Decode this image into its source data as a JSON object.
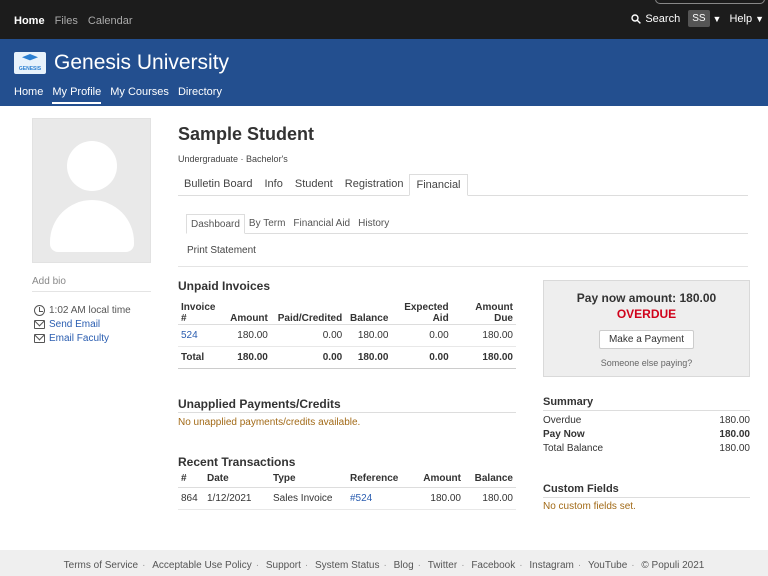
{
  "topnav": {
    "items": [
      "Home",
      "Files",
      "Calendar"
    ],
    "search": "Search",
    "avatar": "SS",
    "help": "Help"
  },
  "brand": {
    "logo_text": "GENESIS",
    "name": "Genesis University"
  },
  "mainnav": [
    "Home",
    "My Profile",
    "My Courses",
    "Directory"
  ],
  "profile": {
    "add_bio": "Add bio",
    "local_time": "1:02 AM local time",
    "send_email": "Send Email",
    "email_faculty": "Email Faculty",
    "name": "Sample Student",
    "subtitle": "Undergraduate · Bachelor's",
    "tabs": [
      "Bulletin Board",
      "Info",
      "Student",
      "Registration",
      "Financial"
    ],
    "subtabs": [
      "Dashboard",
      "By Term",
      "Financial Aid",
      "History"
    ],
    "print": "Print Statement"
  },
  "invoices": {
    "title": "Unpaid Invoices",
    "headers": [
      "Invoice #",
      "Amount",
      "Paid/Credited",
      "Balance",
      "Expected Aid",
      "Amount Due"
    ],
    "rows": [
      [
        "524",
        "180.00",
        "0.00",
        "180.00",
        "0.00",
        "180.00"
      ]
    ],
    "total": [
      "Total",
      "180.00",
      "0.00",
      "180.00",
      "0.00",
      "180.00"
    ]
  },
  "unapplied": {
    "title": "Unapplied Payments/Credits",
    "empty": "No unapplied payments/credits available."
  },
  "transactions": {
    "title": "Recent Transactions",
    "headers": [
      "#",
      "Date",
      "Type",
      "Reference",
      "Amount",
      "Balance"
    ],
    "rows": [
      [
        "864",
        "1/12/2021",
        "Sales Invoice",
        "#524",
        "180.00",
        "180.00"
      ]
    ]
  },
  "paynow": {
    "amount": "Pay now amount: 180.00",
    "status": "OVERDUE",
    "button": "Make a Payment",
    "other": "Someone else paying?"
  },
  "summary": {
    "title": "Summary",
    "rows": [
      [
        "Overdue",
        "180.00"
      ],
      [
        "Pay Now",
        "180.00"
      ],
      [
        "Total Balance",
        "180.00"
      ]
    ]
  },
  "custom_fields": {
    "title": "Custom Fields",
    "empty": "No custom fields set."
  },
  "footer": [
    "Terms of Service",
    "Acceptable Use Policy",
    "Support",
    "System Status",
    "Blog",
    "Twitter",
    "Facebook",
    "Instagram",
    "YouTube",
    "© Populi 2021"
  ],
  "colors": {
    "header": "#234f8f",
    "topbar": "#1c1c1c",
    "overdue": "#d0021b",
    "link": "#2a5db0",
    "notice": "#a26a17"
  }
}
